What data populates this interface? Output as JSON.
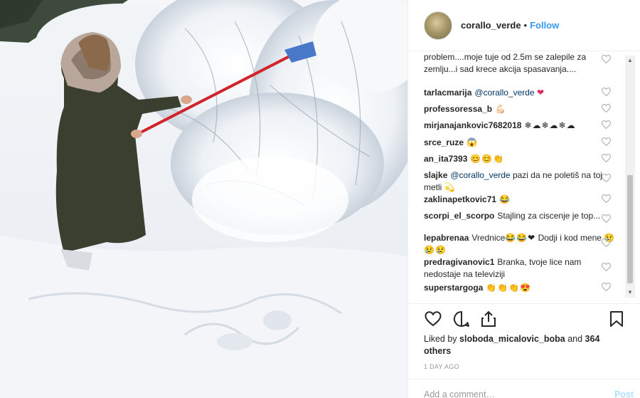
{
  "post": {
    "username": "corallo_verde",
    "separator": "•",
    "follow_label": "Follow"
  },
  "comments": [
    {
      "user": "",
      "text": "problem....moje tuje od 2.5m se zalepile za zemlju...i sad krece akcija spasavanja....",
      "emoji": ""
    },
    {
      "user": "tarlacmarija",
      "mention": "@corallo_verde",
      "text": "",
      "emoji": "❤"
    },
    {
      "user": "professoressa_b",
      "text": "",
      "emoji": "💪🏻"
    },
    {
      "user": "mirjanajankovic7682018",
      "text": "",
      "emoji": "❄☁❄☁❄☁"
    },
    {
      "user": "srce_ruze",
      "text": "",
      "emoji": "😱"
    },
    {
      "user": "an_ita7393",
      "text": "",
      "emoji": "😊😊👏"
    },
    {
      "user": "slajke",
      "mention": "@corallo_verde",
      "text": "pazi da ne poletiš na toj metli",
      "emoji": "💫"
    },
    {
      "user": "zaklinapetkovic71",
      "text": "",
      "emoji": "😂"
    },
    {
      "user": "scorpi_el_scorpo",
      "text": "Stajling za ciscenje je top...",
      "emoji": ""
    },
    {
      "user": "lepabrenaa",
      "text": "Vrednice",
      "text2": "Dodji i kod mene",
      "emoji": "😂😂❤",
      "emoji2": "😢😢😢"
    },
    {
      "user": "predragivanovic1",
      "text": "Branka, tvoje lice nam nedostaje na televiziji",
      "emoji": ""
    },
    {
      "user": "superstargoga",
      "text": "",
      "emoji": "👏👏👏😍"
    }
  ],
  "likes": {
    "prefix": "Liked by",
    "user": "sloboda_micalovic_boba",
    "and": "and",
    "others": "364 others"
  },
  "time_ago": "1 DAY AGO",
  "add_comment": {
    "placeholder": "Add a comment…",
    "post_label": "Post"
  },
  "icons": {
    "like": "heart-outline-icon",
    "comment": "speech-bubble-icon",
    "share": "share-arrow-icon",
    "save": "bookmark-icon",
    "comment_like": "small-heart-icon"
  },
  "colors": {
    "follow": "#3897f0",
    "text": "#262626",
    "muted": "#999999",
    "coat": "#3a3f30",
    "broom": "#d1232a",
    "heart_emoji": "#e0245e"
  }
}
